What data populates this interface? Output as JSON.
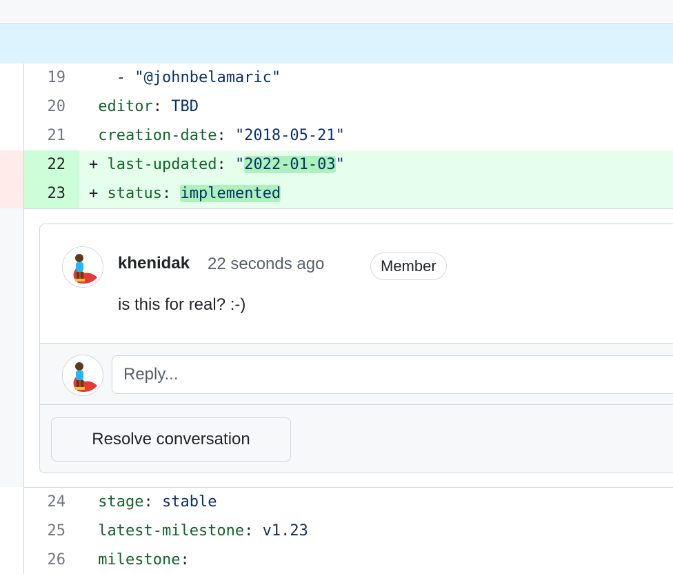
{
  "diff": {
    "lines_top": [
      {
        "num": "19",
        "key": "",
        "sep": "",
        "value": "- \"@johnbelamaric\"",
        "kind": "context"
      },
      {
        "num": "20",
        "key": "editor",
        "sep": ": ",
        "value": "TBD",
        "kind": "context"
      },
      {
        "num": "21",
        "key": "creation-date",
        "sep": ": ",
        "value": "\"2018-05-21\"",
        "kind": "context"
      }
    ],
    "lines_added": [
      {
        "num": "22",
        "prefix": "+ ",
        "key": "last-updated",
        "sep": ": ",
        "q1": "\"",
        "value": "2022-01-03",
        "q2": "\"",
        "kind": "added"
      },
      {
        "num": "23",
        "prefix": "+ ",
        "key": "status",
        "sep": ": ",
        "value": "implemented",
        "kind": "added"
      }
    ],
    "lines_bottom": [
      {
        "num": "24",
        "key": "stage",
        "sep": ": ",
        "value": "stable",
        "kind": "context"
      },
      {
        "num": "25",
        "key": "latest-milestone",
        "sep": ": ",
        "value": "v1.23",
        "kind": "context"
      },
      {
        "num": "26",
        "key": "milestone",
        "sep": ":",
        "value": "",
        "kind": "context"
      }
    ]
  },
  "comment": {
    "author": "khenidak",
    "time": "22 seconds ago",
    "badge": "Member",
    "text": "is this for real? :-)",
    "reply_placeholder": "Reply...",
    "resolve_label": "Resolve conversation"
  },
  "colors": {
    "added_bg": "#e6ffec",
    "added_num_bg": "#ccffd8",
    "added_highlight": "#abf2bc",
    "hunk_bg": "#ddf4ff",
    "yaml_key": "#116329",
    "yaml_value": "#0a3069"
  },
  "icons": {
    "avatar": "superhero-avatar"
  }
}
